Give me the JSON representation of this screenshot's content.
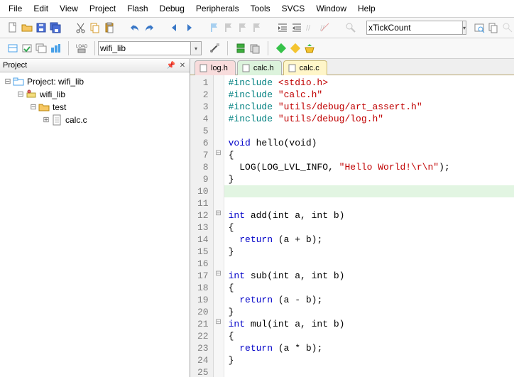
{
  "menu": {
    "items": [
      "File",
      "Edit",
      "View",
      "Project",
      "Flash",
      "Debug",
      "Peripherals",
      "Tools",
      "SVCS",
      "Window",
      "Help"
    ]
  },
  "toolbar1": {
    "quickbox": "xTickCount"
  },
  "toolbar2": {
    "target": "wifi_lib",
    "load_label": "LOAD"
  },
  "project_panel": {
    "title": "Project",
    "root": "Project: wifi_lib",
    "target": "wifi_lib",
    "group": "test",
    "file": "calc.c"
  },
  "tabs": [
    {
      "label": "log.h",
      "kind": "red"
    },
    {
      "label": "calc.h",
      "kind": "green"
    },
    {
      "label": "calc.c",
      "kind": "yellow"
    }
  ],
  "code": {
    "lines": [
      {
        "n": 1,
        "pp": "#include ",
        "inc": "<stdio.h>"
      },
      {
        "n": 2,
        "pp": "#include ",
        "str": "\"calc.h\""
      },
      {
        "n": 3,
        "pp": "#include ",
        "str": "\"utils/debug/art_assert.h\""
      },
      {
        "n": 4,
        "pp": "#include ",
        "str": "\"utils/debug/log.h\""
      },
      {
        "n": 5,
        "blank": true
      },
      {
        "n": 6,
        "sig": "void hello(void)",
        "kw": [
          "void",
          "void"
        ]
      },
      {
        "n": 7,
        "t": "{",
        "fold": "-"
      },
      {
        "n": 8,
        "body": "  LOG(LOG_LVL_INFO, ",
        "str": "\"Hello World!\\r\\n\"",
        "tail": ");"
      },
      {
        "n": 9,
        "t": "}"
      },
      {
        "n": 10,
        "blank": true,
        "hl": true
      },
      {
        "n": 11,
        "sig": "int add(int a, int b)",
        "kw": [
          "int",
          "int",
          "int"
        ]
      },
      {
        "n": 12,
        "t": "{",
        "fold": "-"
      },
      {
        "n": 13,
        "ret": "  return (a + b);",
        "kw": [
          "return"
        ]
      },
      {
        "n": 14,
        "t": "}"
      },
      {
        "n": 15,
        "blank": true
      },
      {
        "n": 16,
        "sig": "int sub(int a, int b)",
        "kw": [
          "int",
          "int",
          "int"
        ]
      },
      {
        "n": 17,
        "t": "{",
        "fold": "-"
      },
      {
        "n": 18,
        "ret": "  return (a - b);",
        "kw": [
          "return"
        ]
      },
      {
        "n": 19,
        "t": "}"
      },
      {
        "n": 20,
        "sig": "int mul(int a, int b)",
        "kw": [
          "int",
          "int",
          "int"
        ]
      },
      {
        "n": 21,
        "t": "{",
        "fold": "-"
      },
      {
        "n": 22,
        "ret": "  return (a * b);",
        "kw": [
          "return"
        ]
      },
      {
        "n": 23,
        "t": "}"
      },
      {
        "n": 24,
        "blank": true
      },
      {
        "n": 25,
        "blank": true
      }
    ]
  }
}
